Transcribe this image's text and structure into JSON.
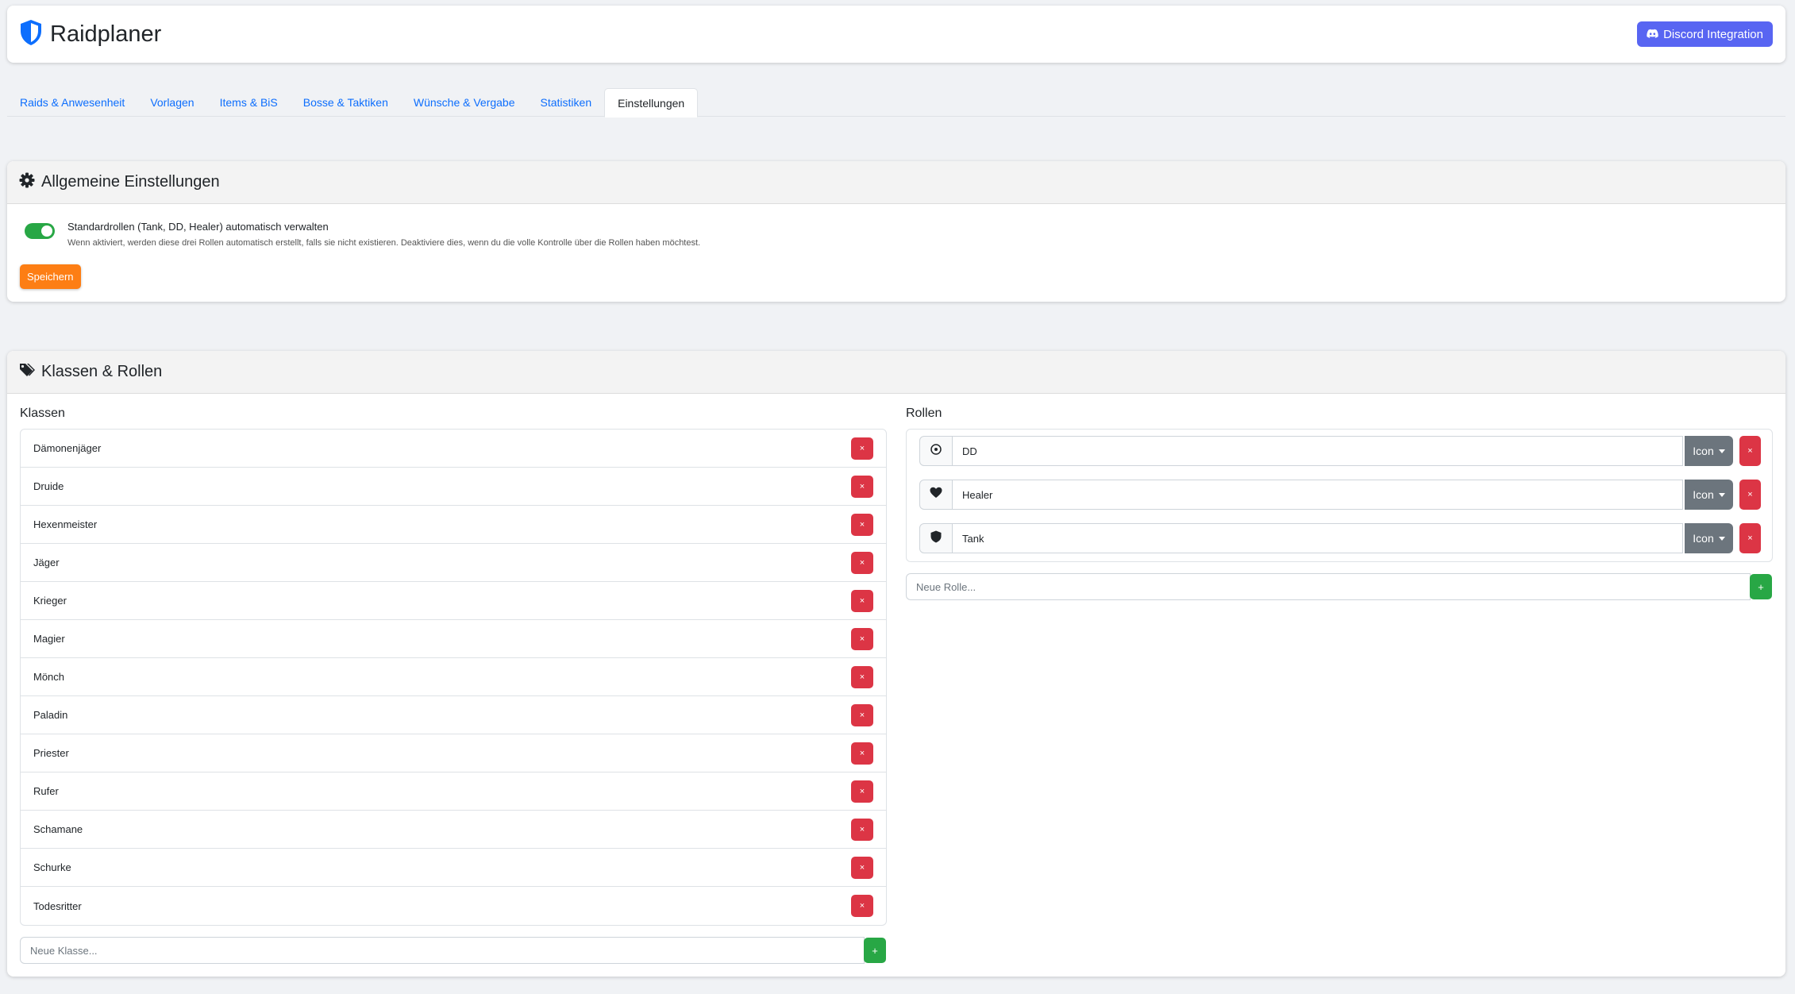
{
  "app": {
    "title": "Raidplaner",
    "discord_label": "Discord Integration"
  },
  "tabs": [
    {
      "label": "Raids & Anwesenheit",
      "active": false
    },
    {
      "label": "Vorlagen",
      "active": false
    },
    {
      "label": "Items & BiS",
      "active": false
    },
    {
      "label": "Bosse & Taktiken",
      "active": false
    },
    {
      "label": "Wünsche & Vergabe",
      "active": false
    },
    {
      "label": "Statistiken",
      "active": false
    },
    {
      "label": "Einstellungen",
      "active": true
    }
  ],
  "general": {
    "title": "Allgemeine Einstellungen",
    "toggle_label": "Standardrollen (Tank, DD, Healer) automatisch verwalten",
    "toggle_desc": "Wenn aktiviert, werden diese drei Rollen automatisch erstellt, falls sie nicht existieren. Deaktiviere dies, wenn du die volle Kontrolle über die Rollen haben möchtest.",
    "toggle_on": true,
    "save_label": "Speichern"
  },
  "classes_roles": {
    "title": "Klassen & Rollen",
    "classes_title": "Klassen",
    "roles_title": "Rollen",
    "classes": [
      "Dämonenjäger",
      "Druide",
      "Hexenmeister",
      "Jäger",
      "Krieger",
      "Magier",
      "Mönch",
      "Paladin",
      "Priester",
      "Rufer",
      "Schamane",
      "Schurke",
      "Todesritter"
    ],
    "roles": [
      {
        "name": "DD",
        "icon": "crosshair-icon"
      },
      {
        "name": "Healer",
        "icon": "heart-icon"
      },
      {
        "name": "Tank",
        "icon": "shield-icon"
      }
    ],
    "icon_label": "Icon",
    "delete_label": "×",
    "add_label": "+",
    "new_class_placeholder": "Neue Klasse...",
    "new_role_placeholder": "Neue Rolle..."
  },
  "colors": {
    "accent": "#0d6efd",
    "discord": "#5865f2",
    "danger": "#dc3545",
    "success": "#28a745",
    "warning": "#fd7e14",
    "secondary": "#6c757d"
  }
}
